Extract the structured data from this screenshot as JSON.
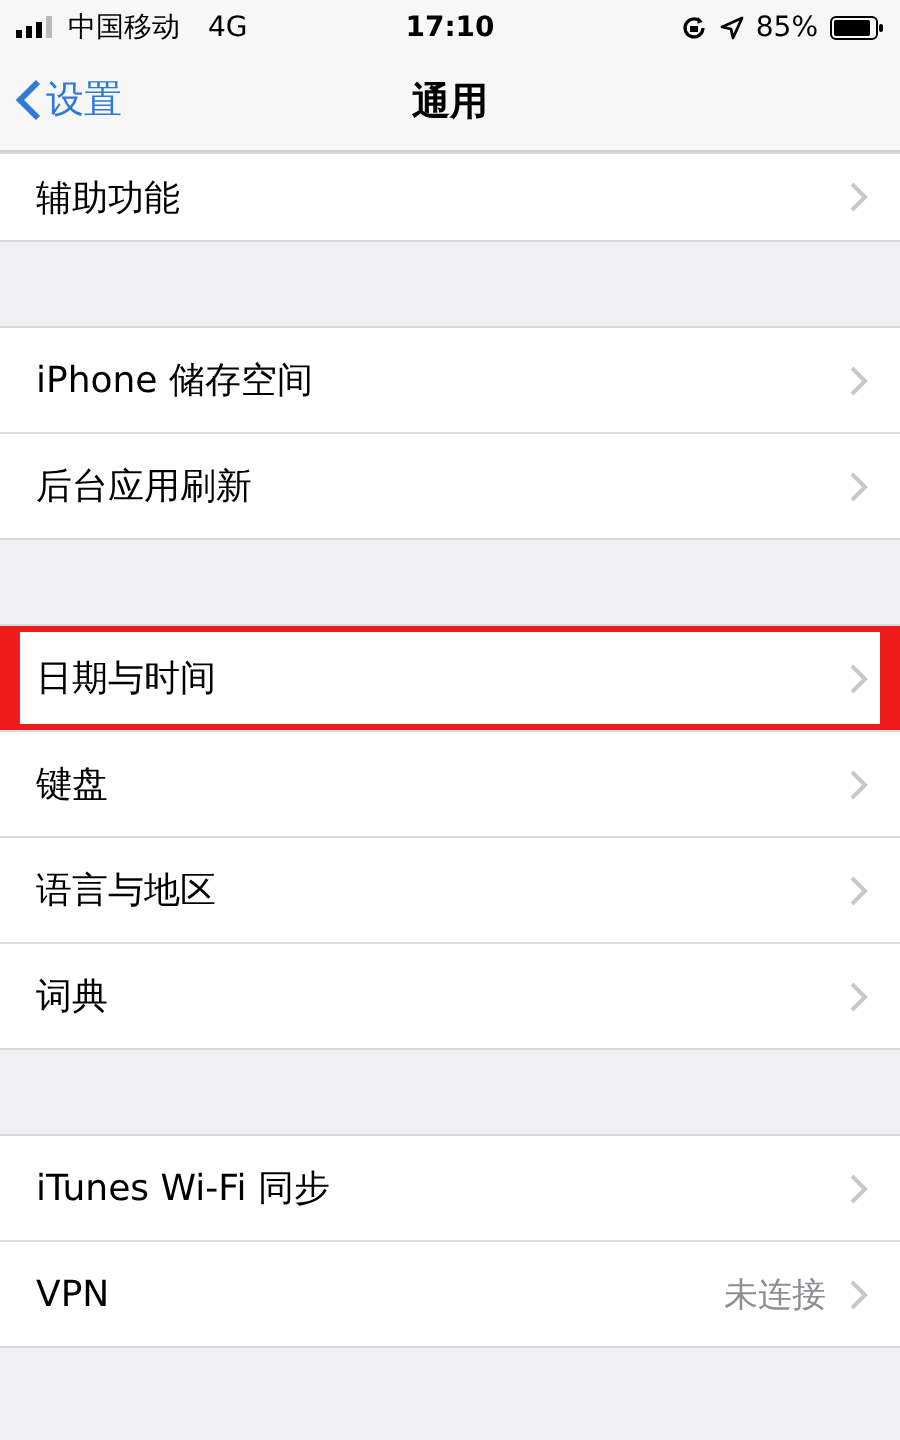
{
  "status_bar": {
    "carrier": "中国移动",
    "network": "4G",
    "time": "17:10",
    "battery": "85%"
  },
  "nav": {
    "back": "设置",
    "title": "通用"
  },
  "groups": [
    {
      "rows": [
        {
          "label": "辅助功能",
          "highlighted": false
        }
      ]
    },
    {
      "rows": [
        {
          "label": "iPhone 储存空间",
          "highlighted": false
        },
        {
          "label": "后台应用刷新",
          "highlighted": false
        }
      ]
    },
    {
      "rows": [
        {
          "label": "日期与时间",
          "highlighted": true
        },
        {
          "label": "键盘",
          "highlighted": false
        },
        {
          "label": "语言与地区",
          "highlighted": false
        },
        {
          "label": "词典",
          "highlighted": false
        }
      ]
    },
    {
      "rows": [
        {
          "label": "iTunes Wi-Fi 同步",
          "highlighted": false
        },
        {
          "label": "VPN",
          "value": "未连接",
          "highlighted": false
        }
      ]
    }
  ]
}
